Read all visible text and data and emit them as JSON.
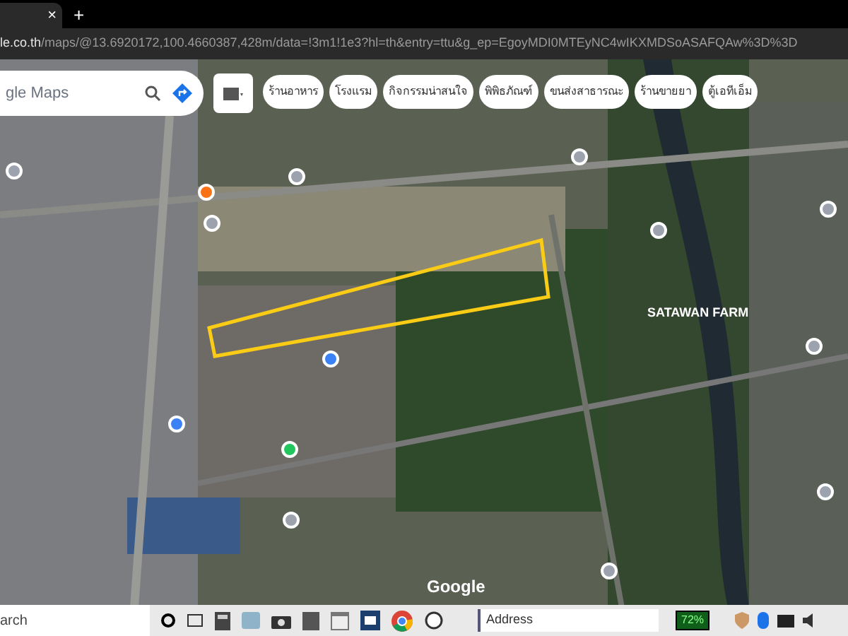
{
  "browser": {
    "tab_close": "×",
    "new_tab": "+",
    "url_host": "le.co.th",
    "url_path": "/maps/@13.6920172,100.4660387,428m/data=!3m1!1e3?hl=th&entry=ttu&g_ep=EgoyMDI0MTEyNC4wIKXMDSoASAFQAw%3D%3D"
  },
  "maps": {
    "search": {
      "placeholder": "gle Maps"
    },
    "chips": [
      {
        "label": "ร้านอาหาร"
      },
      {
        "label": "โรงแรม"
      },
      {
        "label": "กิจกรรมน่าสนใจ"
      },
      {
        "label": "พิพิธภัณฑ์"
      },
      {
        "label": "ขนส่งสาธารณะ"
      },
      {
        "label": "ร้านขายยา"
      },
      {
        "label": "ตู้เอทีเอ็ม"
      }
    ],
    "place_label": "SATAWAN FARM",
    "logo": "Google",
    "pins": [
      {
        "color": "#9ca3af"
      },
      {
        "color": "#f97316"
      },
      {
        "color": "#9ca3af"
      },
      {
        "color": "#9ca3af"
      },
      {
        "color": "#3b82f6"
      },
      {
        "color": "#3b82f6"
      },
      {
        "color": "#22c55e"
      },
      {
        "color": "#9ca3af"
      },
      {
        "color": "#9ca3af"
      },
      {
        "color": "#9ca3af"
      },
      {
        "color": "#9ca3af"
      },
      {
        "color": "#9ca3af"
      },
      {
        "color": "#9ca3af"
      },
      {
        "color": "#9ca3af"
      }
    ]
  },
  "taskbar": {
    "search": {
      "placeholder": "arch"
    },
    "address_label": "Address",
    "battery": "72%"
  }
}
